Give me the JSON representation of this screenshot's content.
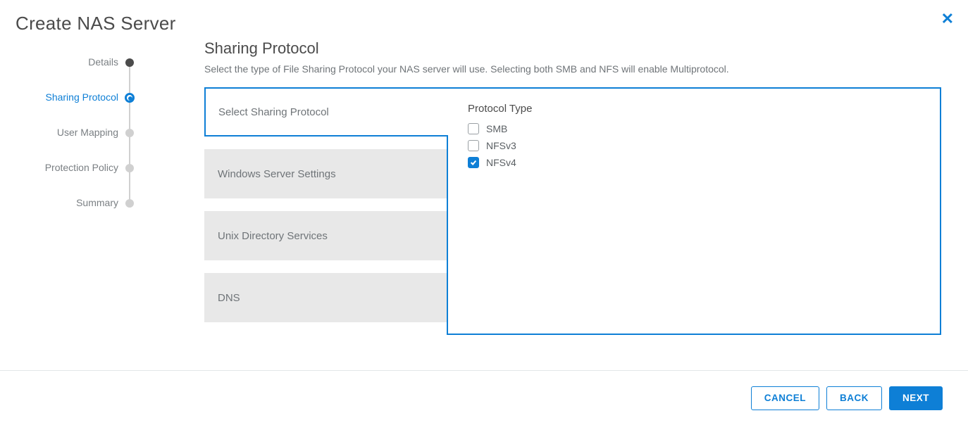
{
  "colors": {
    "accent": "#0e7fd6"
  },
  "title": "Create NAS Server",
  "stepper": {
    "items": [
      {
        "label": "Details",
        "state": "done"
      },
      {
        "label": "Sharing Protocol",
        "state": "current"
      },
      {
        "label": "User Mapping",
        "state": "future"
      },
      {
        "label": "Protection Policy",
        "state": "future"
      },
      {
        "label": "Summary",
        "state": "future"
      }
    ]
  },
  "section": {
    "title": "Sharing Protocol",
    "description": "Select the type of File Sharing Protocol your NAS server will use. Selecting both SMB and NFS will enable Multiprotocol."
  },
  "cards": [
    {
      "label": "Select Sharing Protocol",
      "active": true
    },
    {
      "label": "Windows Server Settings",
      "active": false
    },
    {
      "label": "Unix Directory Services",
      "active": false
    },
    {
      "label": "DNS",
      "active": false
    }
  ],
  "protocol_panel": {
    "heading": "Protocol Type",
    "options": [
      {
        "label": "SMB",
        "checked": false
      },
      {
        "label": "NFSv3",
        "checked": false
      },
      {
        "label": "NFSv4",
        "checked": true
      }
    ]
  },
  "footer": {
    "cancel": "CANCEL",
    "back": "BACK",
    "next": "NEXT"
  }
}
